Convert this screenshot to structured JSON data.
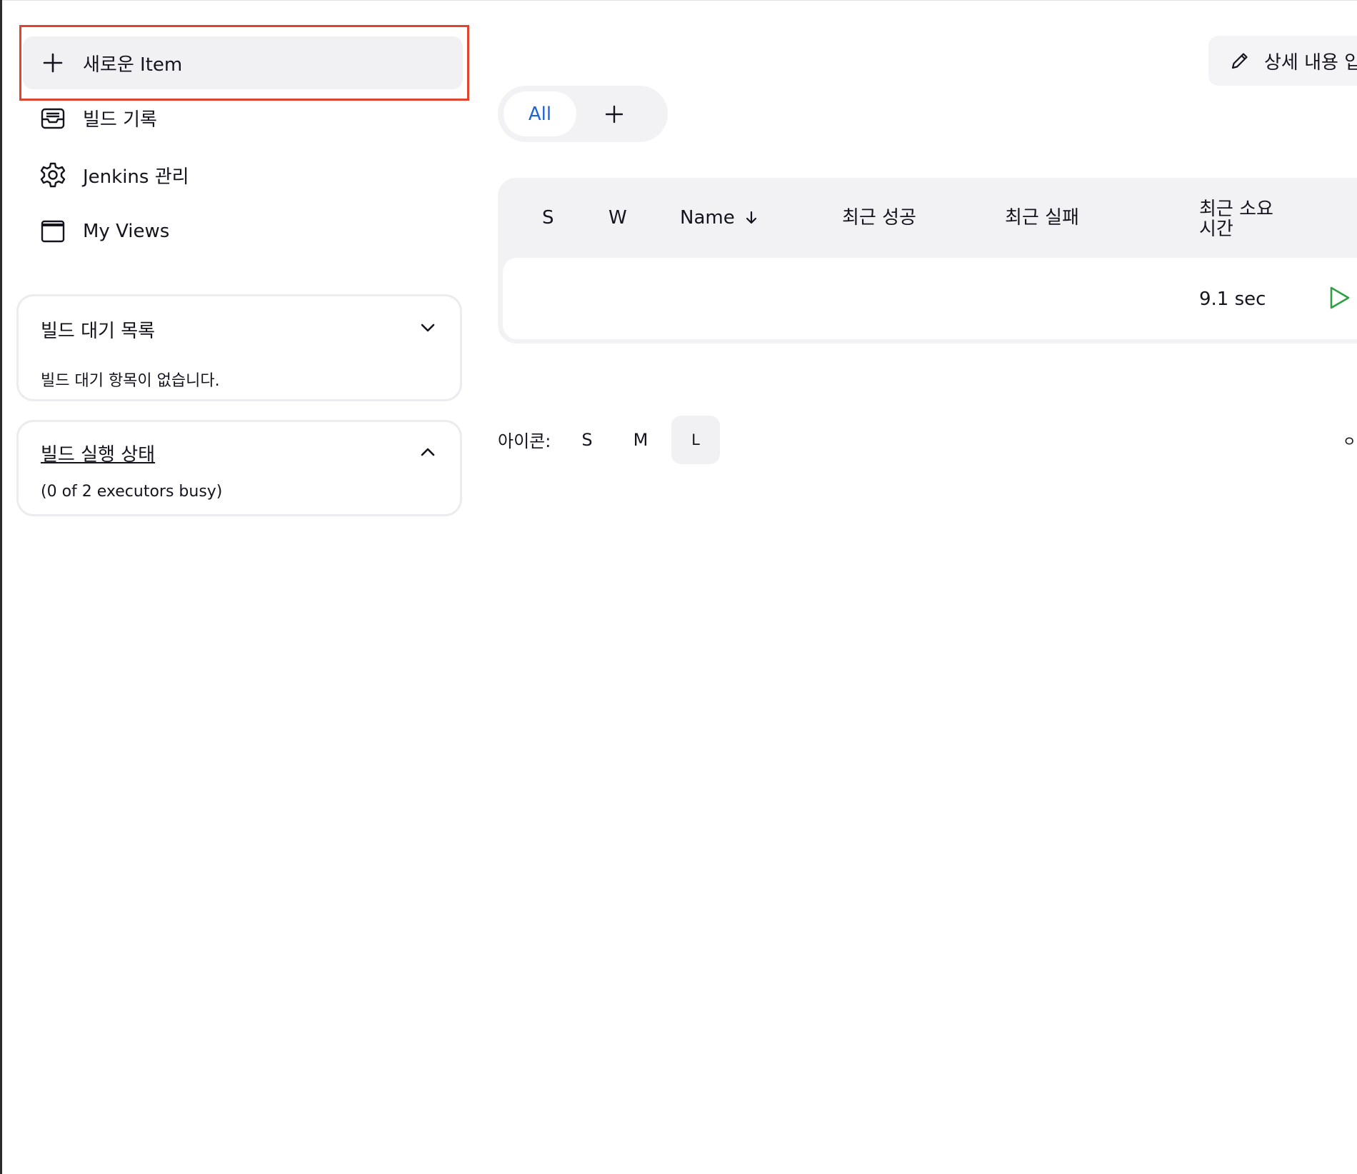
{
  "sidebar": {
    "tasks": [
      {
        "label": "새로운 Item",
        "icon": "plus-icon",
        "active": true
      },
      {
        "label": "빌드 기록",
        "icon": "inbox-icon"
      },
      {
        "label": "Jenkins 관리",
        "icon": "gear-icon"
      },
      {
        "label": "My Views",
        "icon": "window-icon"
      }
    ],
    "highlight_color": "#e0442c",
    "build_queue": {
      "title": "빌드 대기 목록",
      "empty_text": "빌드 대기 항목이 없습니다.",
      "toggle_icon": "chevron-down-icon"
    },
    "executor_status": {
      "title": "빌드 실행 상태",
      "summary": "(0 of 2 executors busy)",
      "toggle_icon": "chevron-up-icon"
    }
  },
  "header": {
    "edit_description_label": "상세 내용 입",
    "edit_icon": "pencil-icon"
  },
  "views": {
    "tabs": [
      {
        "label": "All",
        "selected": true
      }
    ],
    "add_tab_icon": "plus-icon",
    "accent_color": "#1f64d6"
  },
  "table": {
    "columns": {
      "status": "S",
      "weather": "W",
      "name": "Name",
      "last_success": "최근 성공",
      "last_failure": "최근 실패",
      "last_duration_line1": "최근 소요",
      "last_duration_line2": "시간"
    },
    "sort_icon": "arrow-down-icon",
    "rows": [
      {
        "duration": "9.1 sec",
        "action_icon": "play-icon",
        "action_color": "#2ea043"
      }
    ]
  },
  "icon_legend": {
    "label": "아이콘:",
    "sizes": [
      "S",
      "M",
      "L"
    ],
    "selected": "L",
    "trailing_glyph": "ㅇ"
  }
}
